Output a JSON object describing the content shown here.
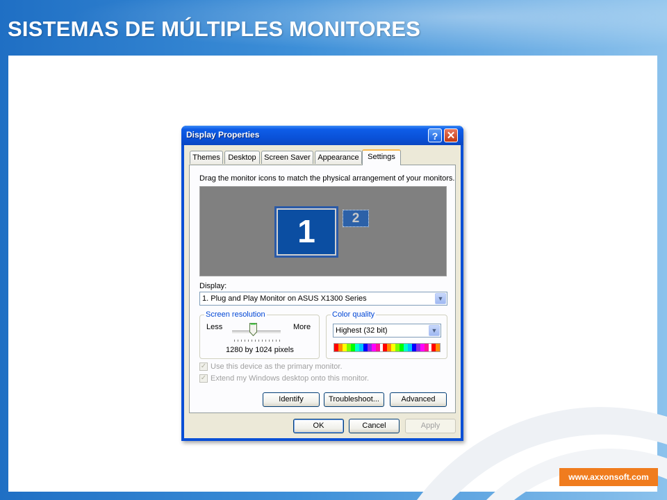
{
  "slide": {
    "title": "SISTEMAS DE MÚLTIPLES MONITORES",
    "url": "www.axxonsoft.com"
  },
  "window": {
    "title": "Display Properties",
    "help_glyph": "?",
    "close_glyph": "✕",
    "tabs": [
      {
        "label": "Themes"
      },
      {
        "label": "Desktop"
      },
      {
        "label": "Screen Saver"
      },
      {
        "label": "Appearance"
      },
      {
        "label": "Settings",
        "active": true
      }
    ],
    "settings": {
      "instruction": "Drag the monitor icons to match the physical arrangement of your monitors.",
      "monitors": [
        {
          "number": "1"
        },
        {
          "number": "2"
        }
      ],
      "display_label": "Display:",
      "display_value": "1. Plug and Play Monitor on ASUS X1300 Series",
      "screen_resolution": {
        "legend": "Screen resolution",
        "less_label": "Less",
        "more_label": "More",
        "value_text": "1280 by 1024 pixels"
      },
      "color_quality": {
        "legend": "Color quality",
        "value": "Highest (32 bit)"
      },
      "checkboxes": [
        {
          "label": "Use this device as the primary monitor.",
          "checked": true,
          "disabled": true
        },
        {
          "label": "Extend my Windows desktop onto this monitor.",
          "checked": true,
          "disabled": true
        }
      ],
      "buttons": {
        "identify": "Identify",
        "troubleshoot": "Troubleshoot...",
        "advanced": "Advanced"
      }
    },
    "footer_buttons": {
      "ok": "OK",
      "cancel": "Cancel",
      "apply": "Apply"
    }
  },
  "colors": {
    "accent_orange": "#f07c1e",
    "xp_blue": "#0a52d9",
    "monitor_blue": "#0b4ea2"
  }
}
